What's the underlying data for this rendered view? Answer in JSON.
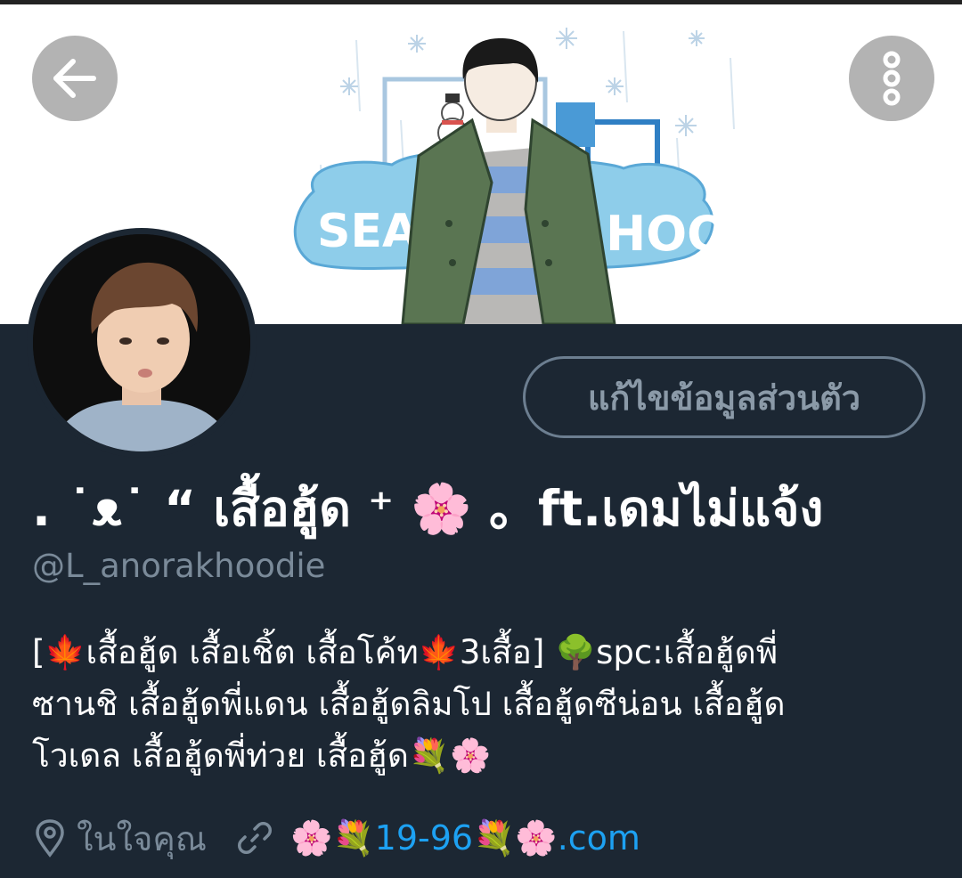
{
  "header": {
    "back_icon": "arrow-left-icon",
    "more_icon": "more-vertical-icon"
  },
  "banner": {
    "text_left": "SEAU",
    "text_right": "HOOD",
    "colors": {
      "sky": "#7ec2e8",
      "cloud": "#8ecdea",
      "coat": "#5a7552",
      "stripe_blue": "#7fa4d8",
      "stripe_grey": "#b9b8b6"
    }
  },
  "profile": {
    "edit_button_label": "แก้ไขข้อมูลส่วนตัว",
    "display_name": ". ˙ᴥ˙ “ เสื้อฮู้ด ⁺ 🌸 。ft.เดมไม่แจ้ง",
    "handle": "@L_anorakhoodie",
    "bio_lines": [
      "[🍁เสื้อฮู้ด เสื้อเชิ้ต เสื้อโค้ท🍁3เสื้อ] 🌳spc:เสื้อฮู้ดพี่",
      "ซานชิ เสื้อฮู้ดพี่แดน เสื้อฮู้ดลิมโป เสื้อฮู้ดซีน่อน เสื้อฮู้ด",
      "โวเดล เสื้อฮู้ดพี่ท่วย เสื้อฮู้ด💐🌸"
    ],
    "location": "ในใจคุณ",
    "website": "🌸💐19-96💐🌸.com",
    "location_icon": "location-pin-icon",
    "link_icon": "link-icon"
  },
  "colors": {
    "background": "#1c2733",
    "link": "#1da1f2",
    "muted": "#7a8a99"
  }
}
